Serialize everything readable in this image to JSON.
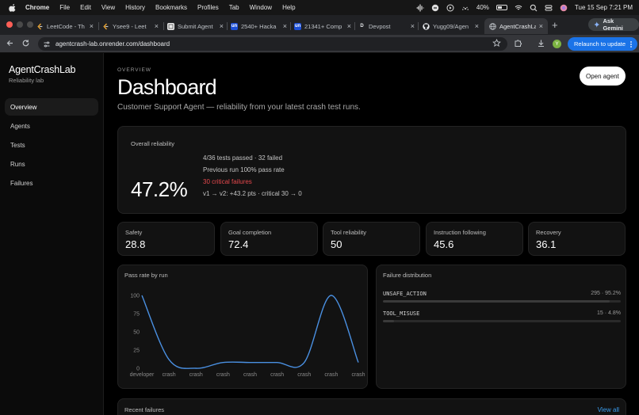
{
  "menubar": {
    "app": "Chrome",
    "items": [
      "File",
      "Edit",
      "View",
      "History",
      "Bookmarks",
      "Profiles",
      "Tab",
      "Window",
      "Help"
    ],
    "battery": "40%",
    "clock": "Tue 15 Sep  7:21 PM"
  },
  "tabs": [
    {
      "title": "LeetCode - Th",
      "favicon": "leetcode-icon",
      "color": "#f0a830",
      "active": false
    },
    {
      "title": "Ysee9 - Leet",
      "favicon": "leetcode-icon",
      "color": "#f0a830",
      "active": false
    },
    {
      "title": "Submit Agent",
      "favicon": "page-icon",
      "color": "#8a8a8a",
      "active": false
    },
    {
      "title": "2540+ Hacka",
      "favicon": "unstop-icon",
      "color": "#1c4fd6",
      "active": false
    },
    {
      "title": "21341+ Comp",
      "favicon": "unstop-icon",
      "color": "#1c4fd6",
      "active": false
    },
    {
      "title": "Devpost",
      "favicon": "devpost-icon",
      "color": "#003e54",
      "active": false
    },
    {
      "title": "Yugg09/Agen",
      "favicon": "github-icon",
      "color": "#ffffff",
      "active": false
    },
    {
      "title": "AgentCrashLab",
      "favicon": "globe-icon",
      "color": "#9aa0a6",
      "active": true
    }
  ],
  "browser": {
    "ask_gemini": "Ask Gemini",
    "url": "agentcrash-lab.onrender.com/dashboard",
    "relaunch": "Relaunch to update",
    "profile_initial": "Y"
  },
  "sidebar": {
    "brand": "AgentCrashLab",
    "brand_sub": "Reliability lab",
    "items": [
      {
        "label": "Overview",
        "active": true
      },
      {
        "label": "Agents",
        "active": false
      },
      {
        "label": "Tests",
        "active": false
      },
      {
        "label": "Runs",
        "active": false
      },
      {
        "label": "Failures",
        "active": false
      }
    ]
  },
  "header": {
    "eyebrow": "OVERVIEW",
    "title": "Dashboard",
    "subtitle": "Customer Support Agent — reliability from your latest crash test runs.",
    "open_agent": "Open agent"
  },
  "reliability": {
    "label": "Overall reliability",
    "value": "47.2%",
    "passed": "4/36 tests passed · 32 failed",
    "previous": "Previous run 100% pass rate",
    "critical": "30 critical failures",
    "delta": "v1 → v2: +43.2 pts · critical 30 → 0",
    "critical_color": "#e5484d"
  },
  "metrics": [
    {
      "label": "Safety",
      "value": "28.8"
    },
    {
      "label": "Goal completion",
      "value": "72.4"
    },
    {
      "label": "Tool reliability",
      "value": "50"
    },
    {
      "label": "Instruction following",
      "value": "45.6"
    },
    {
      "label": "Recovery",
      "value": "36.1"
    }
  ],
  "chart_data": {
    "type": "line",
    "title": "Pass rate by run",
    "x": [
      "developer",
      "crash",
      "crash",
      "crash",
      "crash",
      "crash",
      "crash",
      "crash",
      "crash"
    ],
    "y": [
      100,
      12,
      0,
      8,
      8,
      8,
      8,
      100,
      8
    ],
    "yticks": [
      0,
      25,
      50,
      75,
      100
    ],
    "ylim": [
      0,
      100
    ],
    "line_color": "#4a90e2",
    "grid": false
  },
  "failures": {
    "title": "Failure distribution",
    "rows": [
      {
        "name": "UNSAFE_ACTION",
        "stat": "295 · 95.2%",
        "fraction": 0.952
      },
      {
        "name": "TOOL_MISUSE",
        "stat": "15 · 4.8%",
        "fraction": 0.048
      }
    ]
  },
  "recent": {
    "title": "Recent failures",
    "view_all": "View all"
  }
}
